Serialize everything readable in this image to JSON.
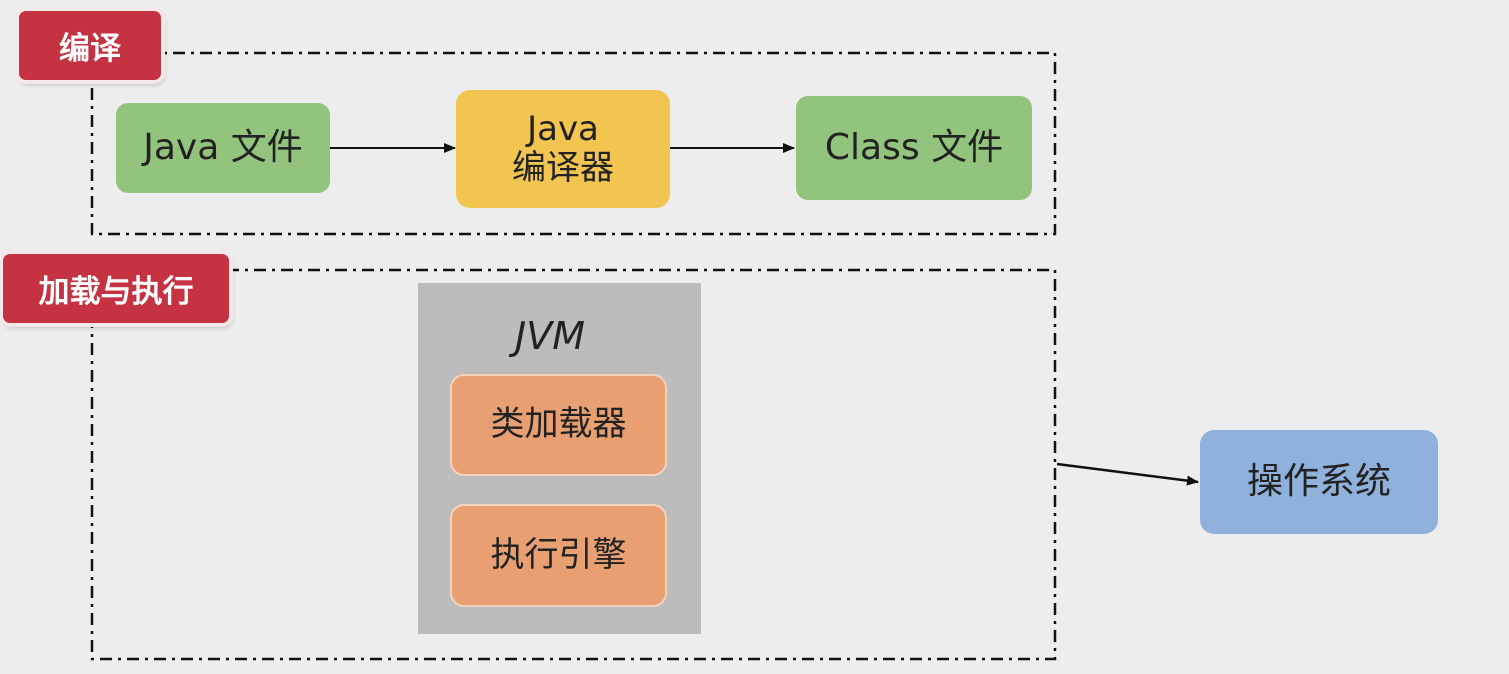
{
  "compile_section": {
    "tag": "编译",
    "java_file": "Java 文件",
    "compiler_line1": "Java",
    "compiler_line2": "编译器",
    "class_file": "Class 文件"
  },
  "load_section": {
    "tag": "加载与执行",
    "jvm_title": "JVM",
    "class_loader": "类加载器",
    "execution_engine": "执行引擎"
  },
  "os_box": "操作系统",
  "colors": {
    "tag": "#c53342",
    "file_box": "#93c47d",
    "compiler_box": "#f1c550",
    "jvm_component": "#e8a072",
    "jvm_container": "#bdbcbd",
    "os_box": "#8fb1db"
  }
}
